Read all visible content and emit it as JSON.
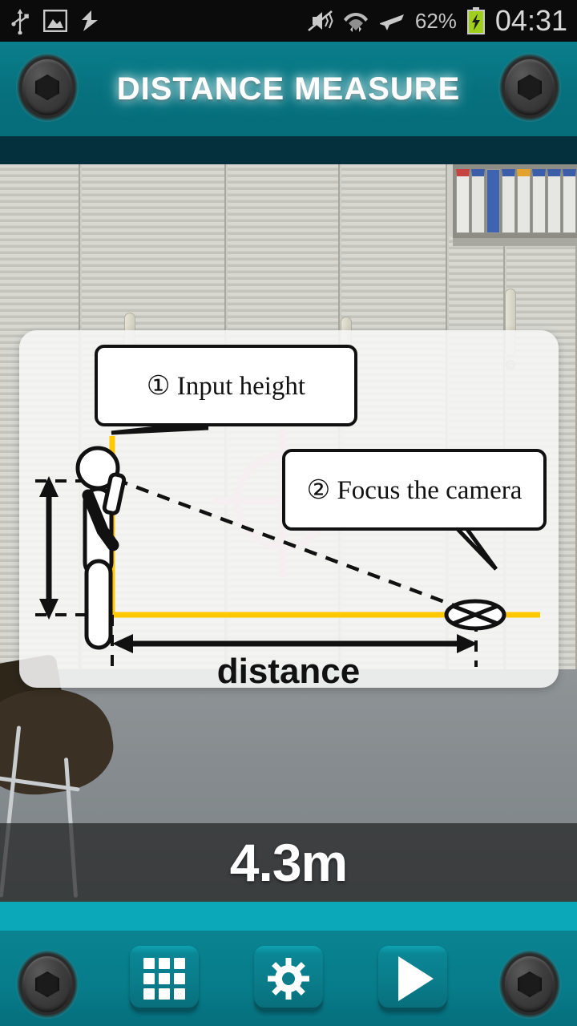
{
  "statusbar": {
    "icons_left": [
      "usb-icon",
      "image-icon",
      "sync-icon"
    ],
    "icons_right": [
      "mute-vibrate-icon",
      "wifi-icon",
      "airplane-mode-icon"
    ],
    "battery_percent": "62%",
    "battery_state": "charging",
    "time": "04:31"
  },
  "header": {
    "title": "DISTANCE MEASURE",
    "left_screw": "screw-icon",
    "right_screw": "screw-icon"
  },
  "camera": {
    "scene": "office lockers and carpeted floor",
    "focus_reticle": "crosshair-target-icon",
    "reticle_color": "#f6bfc8"
  },
  "diagram": {
    "bubble_1": "① Input height",
    "bubble_2": "② Focus the camera",
    "distance_label": "distance",
    "axis_color": "#ffc800",
    "figure": "stick-figure-holding-phone"
  },
  "readout": {
    "value": "4.3m"
  },
  "bottombar": {
    "left_screw": "screw-icon",
    "grid_button": "grid-icon",
    "settings_button": "gear-icon",
    "play_button": "play-icon",
    "right_screw": "screw-icon"
  },
  "colors": {
    "teal": "#07707d",
    "teal_light": "#0aa8b8",
    "navy": "#042f3d",
    "yellow": "#ffc800",
    "pink": "#f6bfc8"
  }
}
